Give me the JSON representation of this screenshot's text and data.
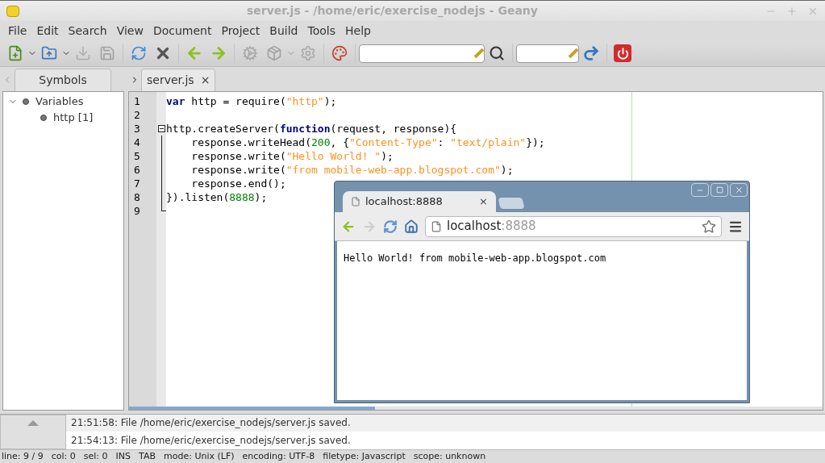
{
  "window": {
    "title": "server.js - /home/eric/exercise_nodejs - Geany"
  },
  "menu": [
    "File",
    "Edit",
    "Search",
    "View",
    "Document",
    "Project",
    "Build",
    "Tools",
    "Help"
  ],
  "sidebar": {
    "tab": {
      "label": "Symbols",
      "selected": true
    },
    "tree": [
      {
        "label": "Variables",
        "expanded": true,
        "children": [
          {
            "label": "http [1]"
          }
        ]
      }
    ]
  },
  "editor": {
    "tabs": [
      {
        "label": "server.js",
        "selected": true,
        "close": "×"
      }
    ],
    "lines": [
      {
        "number": "1",
        "kind": "plain",
        "tokens": [
          {
            "kind": "keyword",
            "text": "var"
          },
          {
            "kind": "plain",
            "text": " http = require("
          },
          {
            "kind": "string",
            "text": "\"http\""
          },
          {
            "kind": "plain",
            "text": ");"
          }
        ]
      },
      {
        "number": "2",
        "kind": "plain"
      },
      {
        "number": "3",
        "kind": "fold_start",
        "tokens": [
          {
            "kind": "plain",
            "text": "http.createServer("
          },
          {
            "kind": "keyword",
            "text": "function"
          },
          {
            "kind": "plain",
            "text": "(request, response){"
          }
        ]
      },
      {
        "number": "4",
        "kind": "fold_body",
        "tokens": [
          {
            "kind": "plain",
            "text": "    response.writeHead("
          },
          {
            "kind": "number",
            "text": "200"
          },
          {
            "kind": "plain",
            "text": ", {"
          },
          {
            "kind": "string",
            "text": "\"Content-Type\""
          },
          {
            "kind": "plain",
            "text": ": "
          },
          {
            "kind": "string",
            "text": "\"text/plain\""
          },
          {
            "kind": "plain",
            "text": "});"
          }
        ]
      },
      {
        "number": "5",
        "kind": "fold_body",
        "tokens": [
          {
            "kind": "plain",
            "text": "    response.write("
          },
          {
            "kind": "string",
            "text": "\"Hello World! \""
          },
          {
            "kind": "plain",
            "text": ");"
          }
        ]
      },
      {
        "number": "6",
        "kind": "fold_body",
        "tokens": [
          {
            "kind": "plain",
            "text": "    response.write("
          },
          {
            "kind": "string",
            "text": "\"from mobile-web-app.blogspot.com\""
          },
          {
            "kind": "plain",
            "text": ");"
          }
        ]
      },
      {
        "number": "7",
        "kind": "fold_body",
        "tokens": [
          {
            "kind": "plain",
            "text": "    response.end();"
          }
        ]
      },
      {
        "number": "8",
        "kind": "fold_body",
        "tokens": [
          {
            "kind": "plain",
            "text": "}).listen("
          },
          {
            "kind": "number",
            "text": "8888"
          },
          {
            "kind": "plain",
            "text": ");"
          }
        ]
      },
      {
        "number": "9",
        "kind": "fold_end"
      }
    ]
  },
  "browser": {
    "tab": {
      "title": "localhost:8888",
      "close": "×",
      "selected": true
    },
    "address": {
      "host": "localhost",
      "port": ":8888"
    },
    "content": "Hello World! from mobile-web-app.blogspot.com"
  },
  "messages": [
    "21:51:58: File /home/eric/exercise_nodejs/server.js saved.",
    "21:54:13: File /home/eric/exercise_nodejs/server.js saved."
  ],
  "status_bar": [
    "line: 9 / 9",
    "col: 0",
    "sel: 0",
    "INS",
    "TAB",
    "mode: Unix (LF)",
    "encoding: UTF-8",
    "filetype: Javascript",
    "scope: unknown"
  ]
}
